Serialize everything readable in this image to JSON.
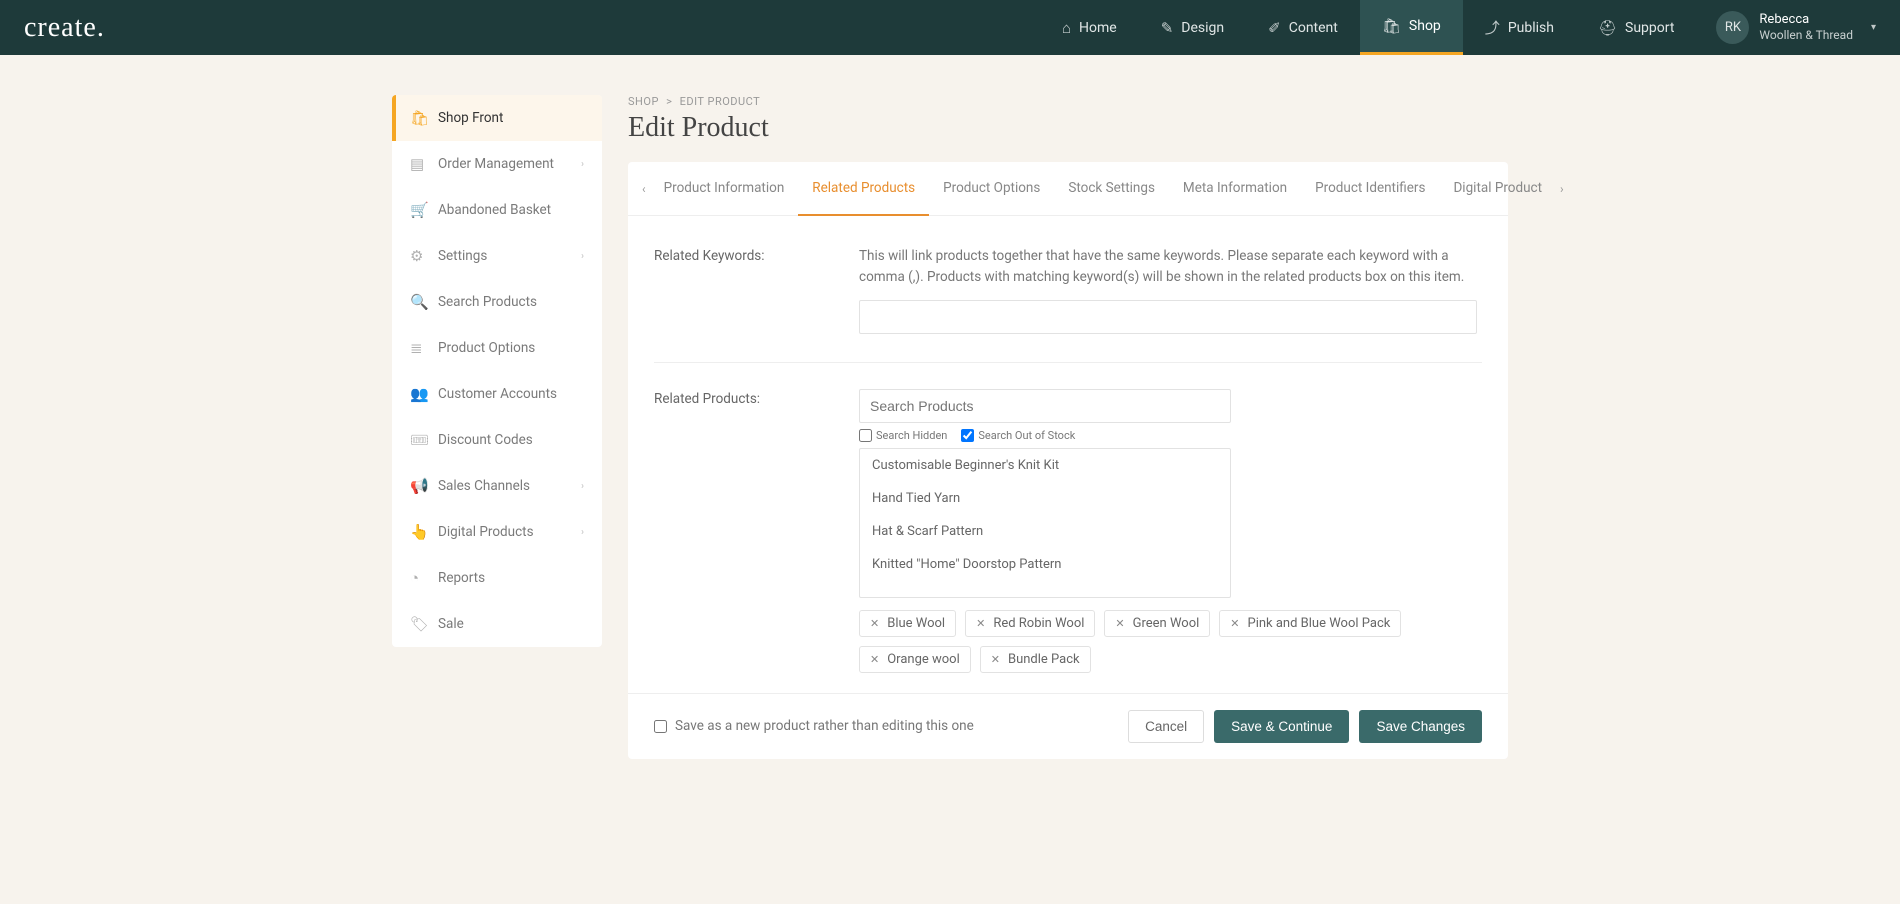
{
  "logo": "create.",
  "nav": [
    {
      "label": "Home",
      "icon": "⌂"
    },
    {
      "label": "Design",
      "icon": "✎"
    },
    {
      "label": "Content",
      "icon": "✐"
    },
    {
      "label": "Shop",
      "icon": "🛍",
      "active": true
    },
    {
      "label": "Publish",
      "icon": "⤴"
    },
    {
      "label": "Support",
      "icon": "⛑"
    }
  ],
  "user": {
    "initials": "RK",
    "name": "Rebecca",
    "sub": "Woollen & Thread"
  },
  "sidebar": [
    {
      "label": "Shop Front",
      "icon": "🛍",
      "active": true
    },
    {
      "label": "Order Management",
      "icon": "▤",
      "hasSub": true
    },
    {
      "label": "Abandoned Basket",
      "icon": "🛒"
    },
    {
      "label": "Settings",
      "icon": "⚙",
      "hasSub": true
    },
    {
      "label": "Search Products",
      "icon": "🔍"
    },
    {
      "label": "Product Options",
      "icon": "≣"
    },
    {
      "label": "Customer Accounts",
      "icon": "👥"
    },
    {
      "label": "Discount Codes",
      "icon": "🎟"
    },
    {
      "label": "Sales Channels",
      "icon": "📢",
      "hasSub": true
    },
    {
      "label": "Digital Products",
      "icon": "👆",
      "hasSub": true
    },
    {
      "label": "Reports",
      "icon": "◔"
    },
    {
      "label": "Sale",
      "icon": "🏷"
    }
  ],
  "breadcrumb": {
    "parent": "SHOP",
    "sep": ">",
    "current": "EDIT PRODUCT"
  },
  "pageTitle": "Edit Product",
  "tabs": [
    "Product Information",
    "Related Products",
    "Product Options",
    "Stock Settings",
    "Meta Information",
    "Product Identifiers",
    "Digital Product"
  ],
  "activeTab": 1,
  "form": {
    "keywordsLabel": "Related Keywords:",
    "keywordsHelp": "This will link products together that have the same keywords. Please separate each keyword with a comma (,). Products with matching keyword(s) will be shown in the related products box on this item.",
    "keywordsValue": "",
    "productsLabel": "Related Products:",
    "searchPlaceholder": "Search Products",
    "searchHiddenLabel": "Search Hidden",
    "searchHiddenChecked": false,
    "searchOutLabel": "Search Out of Stock",
    "searchOutChecked": true,
    "productList": [
      "Customisable Beginner's Knit Kit",
      "Hand Tied Yarn",
      "Hat & Scarf Pattern",
      "Knitted \"Home\" Doorstop Pattern"
    ],
    "selectedChips": [
      "Blue Wool",
      "Red Robin Wool",
      "Green Wool",
      "Pink and Blue Wool Pack",
      "Orange wool",
      "Bundle Pack"
    ]
  },
  "footer": {
    "saveAsNewLabel": "Save as a new product rather than editing this one",
    "cancel": "Cancel",
    "saveContinue": "Save & Continue",
    "saveChanges": "Save Changes"
  }
}
